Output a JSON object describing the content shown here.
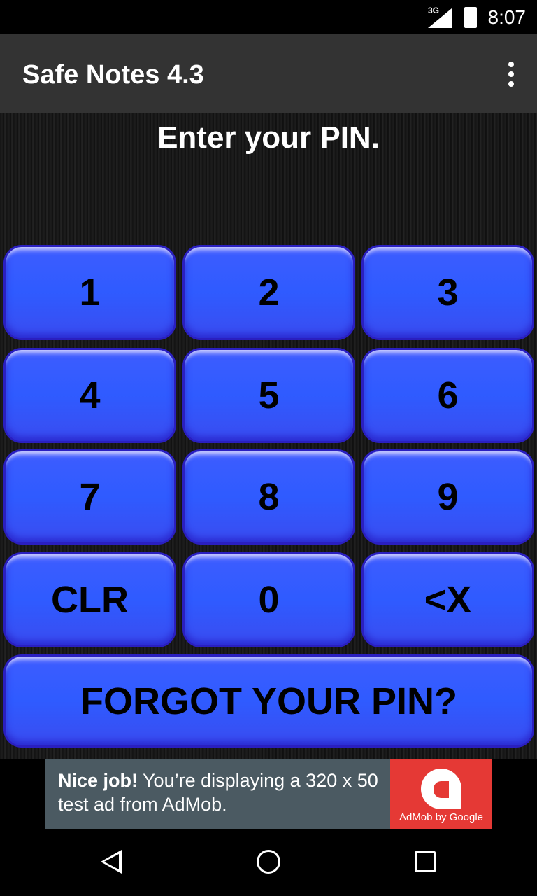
{
  "status_bar": {
    "network": "3G",
    "time": "8:07"
  },
  "app_bar": {
    "title": "Safe Notes 4.3",
    "menu_icon": "more-vert-icon"
  },
  "main": {
    "prompt": "Enter your PIN.",
    "keys": [
      "1",
      "2",
      "3",
      "4",
      "5",
      "6",
      "7",
      "8",
      "9",
      "CLR",
      "0",
      "<X"
    ],
    "forgot_label": "FORGOT YOUR PIN?",
    "key_color": "#2f5bff"
  },
  "ad": {
    "bold": "Nice job!",
    "text": " You’re displaying a 320 x 50 test ad from AdMob.",
    "brand": "AdMob by Google",
    "brand_color": "#e53935"
  },
  "nav_bar": {
    "back": "back-icon",
    "home": "home-icon",
    "recents": "recents-icon"
  }
}
